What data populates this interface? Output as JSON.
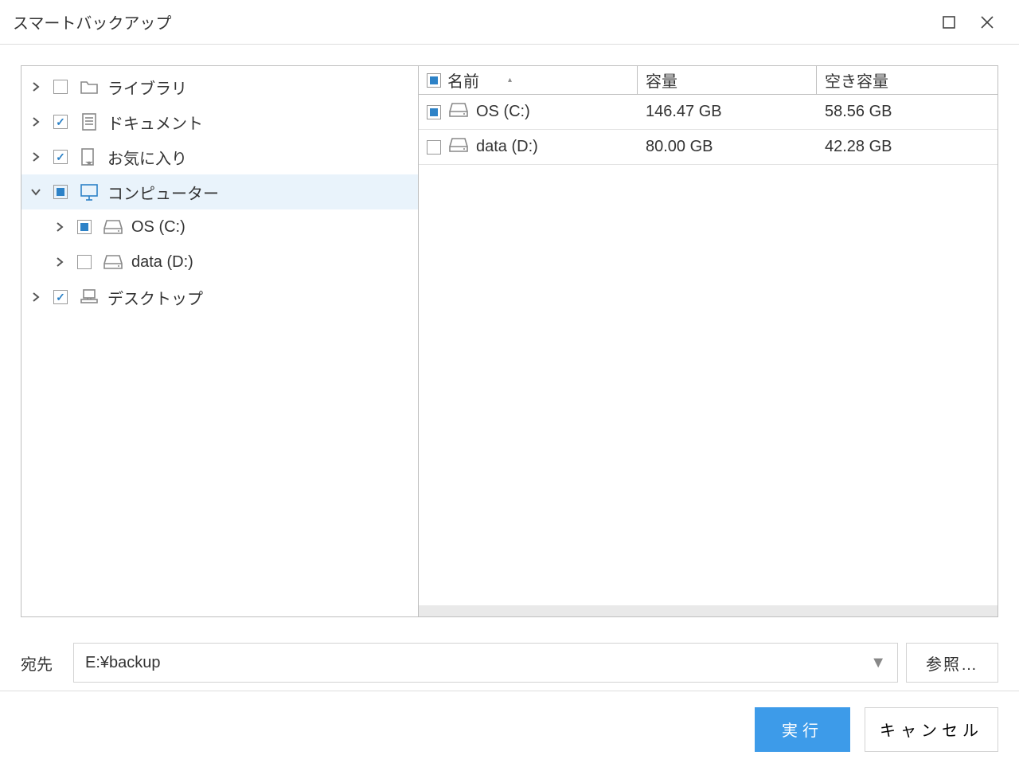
{
  "window": {
    "title": "スマートバックアップ"
  },
  "tree": [
    {
      "label": "ライブラリ",
      "expanded": false,
      "check": "none",
      "icon": "folder",
      "level": 0
    },
    {
      "label": "ドキュメント",
      "expanded": false,
      "check": "checked",
      "icon": "document",
      "level": 0
    },
    {
      "label": "お気に入り",
      "expanded": false,
      "check": "checked",
      "icon": "favorite",
      "level": 0
    },
    {
      "label": "コンピューター",
      "expanded": true,
      "check": "partial",
      "icon": "monitor",
      "level": 0,
      "selected": true
    },
    {
      "label": "OS (C:)",
      "expanded": false,
      "check": "partial",
      "icon": "drive",
      "level": 1
    },
    {
      "label": "data (D:)",
      "expanded": false,
      "check": "none",
      "icon": "drive",
      "level": 1
    },
    {
      "label": "デスクトップ",
      "expanded": false,
      "check": "checked",
      "icon": "desktop",
      "level": 0
    }
  ],
  "columns": {
    "name": "名前",
    "size": "容量",
    "free": "空き容量",
    "header_check": "partial"
  },
  "rows": [
    {
      "name": "OS (C:)",
      "size": "146.47 GB",
      "free": "58.56 GB",
      "check": "partial"
    },
    {
      "name": "data (D:)",
      "size": "80.00 GB",
      "free": "42.28 GB",
      "check": "none"
    }
  ],
  "destination": {
    "label": "宛先",
    "value": "E:¥backup",
    "browse": "参照…"
  },
  "buttons": {
    "run": "実行",
    "cancel": "キャンセル"
  }
}
